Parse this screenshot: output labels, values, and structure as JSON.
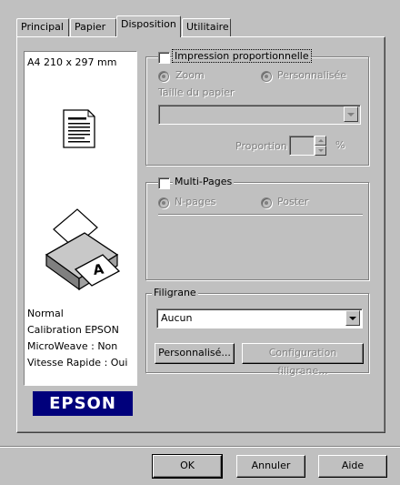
{
  "tabs": [
    {
      "label": "Principal"
    },
    {
      "label": "Papier"
    },
    {
      "label": "Disposition",
      "active": true
    },
    {
      "label": "Utilitaire"
    }
  ],
  "preview": {
    "paper_size": "A4 210 x 297 mm",
    "settings": [
      "Normal",
      "Calibration EPSON",
      "MicroWeave : Non",
      "Vitesse Rapide : Oui"
    ],
    "brand_logo": "EPSON"
  },
  "proportional": {
    "checkbox_label": "Impression proportionnelle",
    "checked": false,
    "radio_zoom": "Zoom",
    "radio_custom": "Personnalisée",
    "paper_size_label": "Taille du papier",
    "paper_size_value": "",
    "proportion_label": "Proportion",
    "proportion_value": "",
    "proportion_unit": "%"
  },
  "multipages": {
    "checkbox_label": "Multi-Pages",
    "checked": false,
    "radio_npages": "N-pages",
    "radio_poster": "Poster"
  },
  "watermark": {
    "group_label": "Filigrane",
    "selected": "Aucun",
    "custom_button": "Personnalisé...",
    "config_button": "Configuration filigrane..."
  },
  "buttons": {
    "ok": "OK",
    "cancel": "Annuler",
    "help": "Aide"
  },
  "colors": {
    "face": "#c0c0c0",
    "brand_bg": "#00007b",
    "brand_fg": "#ffffff"
  }
}
